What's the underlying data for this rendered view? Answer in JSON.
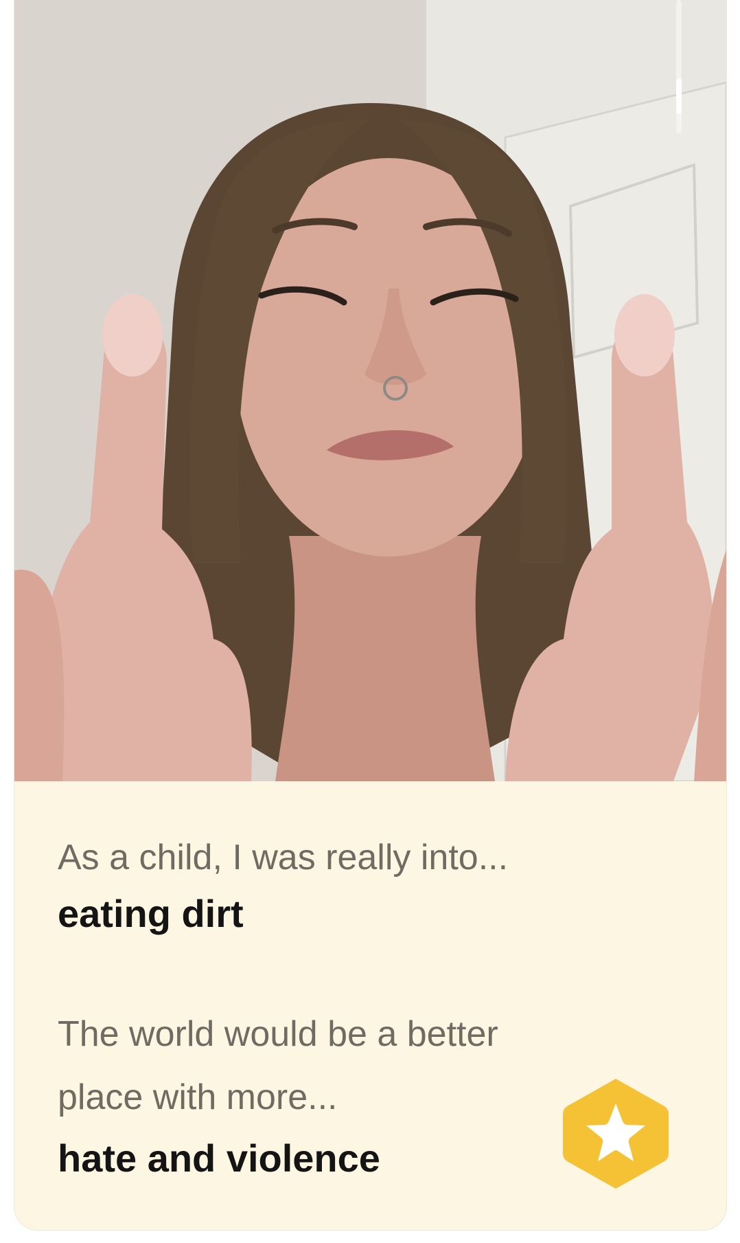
{
  "profile_photo": {
    "alt_icon": "profile-photo",
    "photo_index": 2,
    "photo_count": 6
  },
  "prompts": [
    {
      "question": "As a child, I was really into...",
      "answer": "eating dirt"
    },
    {
      "question": "The world would be a better place with more...",
      "answer": "hate and violence"
    }
  ],
  "actions": {
    "superlike_icon": "star-icon",
    "superlike_color": "#f6c235"
  },
  "colors": {
    "card_background": "#fdf6e3",
    "question_text": "#6f6a62",
    "answer_text": "#141414"
  }
}
